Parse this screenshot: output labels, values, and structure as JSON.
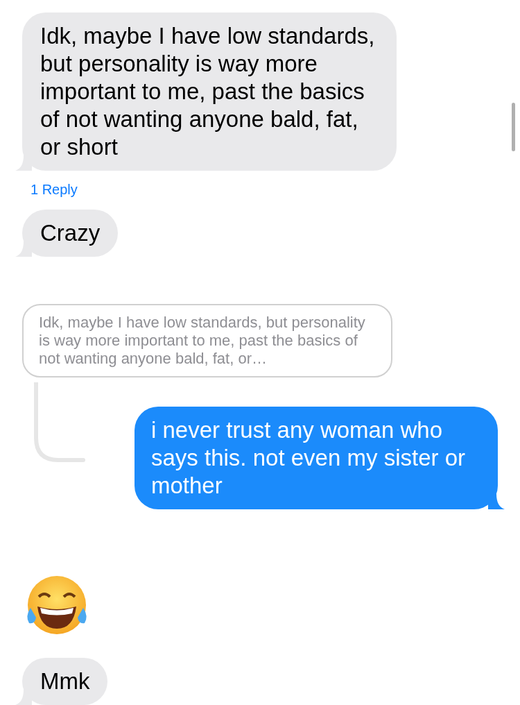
{
  "messages": [
    {
      "kind": "received",
      "text": "Idk, maybe I have low standards, but personality is way more important to me, past the basics of not wanting anyone bald, fat, or short",
      "reply_count": "1 Reply"
    },
    {
      "kind": "received",
      "text": "Crazy"
    },
    {
      "kind": "quote",
      "text": "Idk, maybe I have low standards, but personality is way more important to me, past the basics of not wanting anyone bald, fat, or…"
    },
    {
      "kind": "sent",
      "text": "i never trust any woman who says this. not even my sister or mother"
    },
    {
      "kind": "emoji"
    },
    {
      "kind": "received",
      "text": "Mmk"
    }
  ]
}
